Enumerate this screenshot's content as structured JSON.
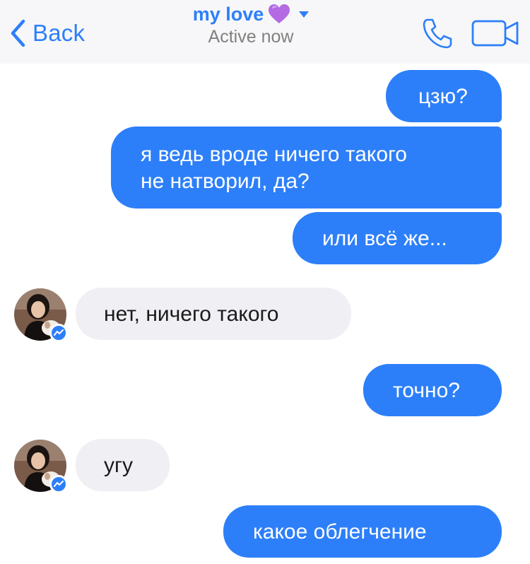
{
  "header": {
    "back_label": "Back",
    "title": "my love",
    "title_emoji": "purple-heart",
    "subtitle": "Active now",
    "accent_color": "#2d7ff9"
  },
  "messages": [
    {
      "from": "me",
      "text": "цзю?"
    },
    {
      "from": "me",
      "lines": [
        "я ведь вроде ничего такого",
        "не натворил, да?"
      ]
    },
    {
      "from": "me",
      "text": "или всё же..."
    },
    {
      "from": "contact",
      "text": "нет, ничего такого"
    },
    {
      "from": "me",
      "text": "точно?"
    },
    {
      "from": "contact",
      "text": "угу"
    },
    {
      "from": "me",
      "text": "какое облегчение"
    }
  ],
  "colors": {
    "outgoing_bubble": "#2d7ff9",
    "incoming_bubble": "#f0eff4",
    "header_background": "#f7f7f9"
  }
}
